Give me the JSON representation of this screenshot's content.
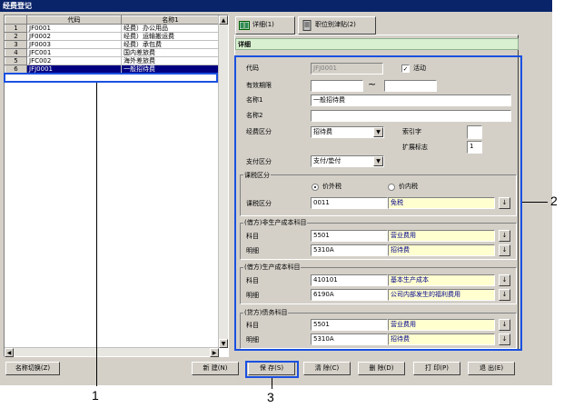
{
  "window": {
    "title": "经费登记"
  },
  "list": {
    "columns": [
      "代码",
      "名称1"
    ],
    "rows": [
      {
        "num": "1",
        "code": "JF0001",
        "name": "经费）办公用品"
      },
      {
        "num": "2",
        "code": "JF0002",
        "name": "经费）运输搬运费"
      },
      {
        "num": "3",
        "code": "JF0003",
        "name": "经费）承包费"
      },
      {
        "num": "4",
        "code": "JFC001",
        "name": "国内差旅费"
      },
      {
        "num": "5",
        "code": "JFC002",
        "name": "海外差旅费"
      },
      {
        "num": "6",
        "code": "JFJ0001",
        "name": "一般招待费"
      }
    ]
  },
  "tabs": [
    {
      "label": "详细(1)"
    },
    {
      "label": "职位别津贴(2)"
    }
  ],
  "detail": {
    "header": "详细",
    "code_label": "代码",
    "code_value": "JFJ0001",
    "active_label": "活动",
    "active_checked": "✓",
    "period_label": "有效期限",
    "period_sep": "~",
    "name1_label": "名称1",
    "name1_value": "一般招待费",
    "name2_label": "名称2",
    "name2_value": "",
    "category_label": "经费区分",
    "category_value": "招待费",
    "index_label": "索引字",
    "index_value": "",
    "ext_label": "扩展标志",
    "ext_value": "1",
    "payment_label": "支付区分",
    "payment_value": "支付/垫付"
  },
  "tax": {
    "group_title": "课税区分",
    "radio1": "价外税",
    "radio2": "价内税",
    "label": "课税区分",
    "code": "0011",
    "name": "免税"
  },
  "debit_nonprod": {
    "group_title": "(借方)非生产成本科目",
    "subject_label": "科目",
    "subject_code": "5501",
    "subject_name": "营业费用",
    "detail_label": "明细",
    "detail_code": "5310A",
    "detail_name": "招待费"
  },
  "debit_prod": {
    "group_title": "(借方)生产成本科目",
    "subject_label": "科目",
    "subject_code": "410101",
    "subject_name": "基本生产成本",
    "detail_label": "明细",
    "detail_code": "6190A",
    "detail_name": "公司内部发生的福利费用"
  },
  "credit": {
    "group_title": "(贷方)债务科目",
    "subject_label": "科目",
    "subject_code": "5501",
    "subject_name": "营业费用",
    "detail_label": "明细",
    "detail_code": "5310A",
    "detail_name": "招待费"
  },
  "buttons": {
    "name_switch": "名称切换(Z)",
    "new": "新 建(N)",
    "save": "保 存(S)",
    "clear": "清 除(C)",
    "delete": "删 除(D)",
    "print": "打 印(P)",
    "exit": "退 出(E)"
  },
  "callouts": {
    "c1": "1",
    "c2": "2",
    "c3": "3"
  },
  "colors": {
    "title_bg": "#0a246a",
    "selected_row": "#000080",
    "highlight_box": "#1a50e0",
    "readonly_field": "#ffffd0"
  }
}
